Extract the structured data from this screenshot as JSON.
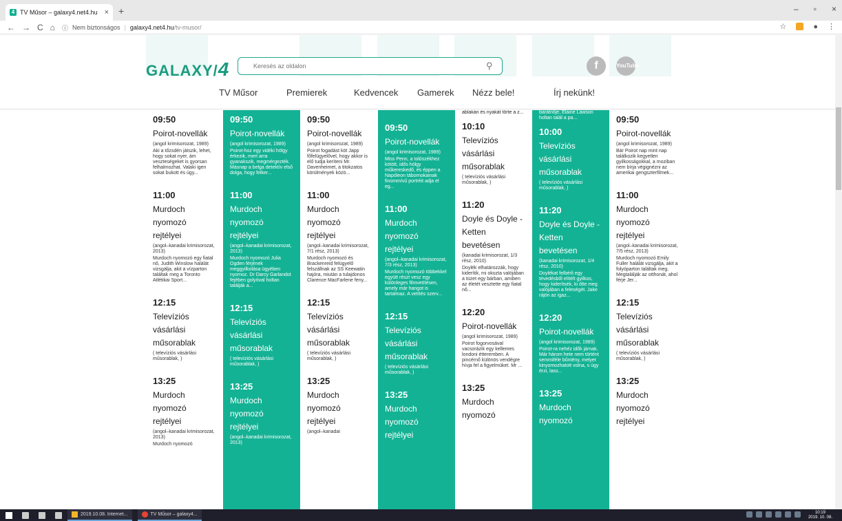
{
  "browser": {
    "tab_title": "TV Műsor – galaxy4.net4.hu",
    "tab_close": "×",
    "new_tab": "+",
    "security_label": "Nem biztonságos",
    "url_host": "galaxy4.net4.hu",
    "url_path": "/tv-musor/",
    "nav_back": "←",
    "nav_forward": "→",
    "nav_reload": "C",
    "nav_home": "⌂",
    "win_min": "–",
    "win_max": "▫",
    "win_close": "×"
  },
  "site": {
    "logo_text": "GALAXY/",
    "logo_four": "4",
    "search_placeholder": "Keresés az oldalon",
    "facebook_glyph": "f",
    "youtube_glyph": "YouTube",
    "menu": [
      "TV Műsor",
      "Premierek",
      "Kedvencek",
      "Gamerek",
      "Nézz bele!",
      "Írj nekünk!"
    ],
    "accent_color": "#14b294"
  },
  "schedule": [
    {
      "style": "white",
      "fragment": "",
      "programs": [
        {
          "time": "09:50",
          "title": "Poirot-novellák",
          "subtitle": "(angol krimisorozat, 1989)",
          "desc": "Aki a tőzsdén játszik, lehet, hogy sokat nyer, ám veszteségeket is gyorsan felhalmozhat. Valaki igen sokat bukott és úgy..."
        },
        {
          "time": "11:00",
          "title": "Murdoch nyomozó rejtélyei",
          "subtitle": "(angol–kanadai krimisorozat, 2013)",
          "desc": "Murdoch nyomozó egy fiatal nő, Judith Winslow halálát vizsgálja, akit a vízparton találtak meg a Toronto Atlétikai Sport..."
        },
        {
          "time": "12:15",
          "title": "Televíziós vásárlási műsorablak",
          "subtitle": "( televíziós vásárlási műsorablak, )",
          "desc": ""
        },
        {
          "time": "13:25",
          "title": "Murdoch nyomozó rejtélyei",
          "subtitle": "(angol–kanadai krimisorozat, 2013)",
          "desc": "Murdoch nyomozó"
        }
      ]
    },
    {
      "style": "green",
      "fragment": "",
      "programs": [
        {
          "time": "09:50",
          "title": "Poirot-novellák",
          "subtitle": "(angol krimisorozat, 1989)",
          "desc": "Poirot-hoz egy vidéki hölgy érkezik, mert arra gyanakszik, megmérgezték. Másnap a belga detektív első dolga, hogy felker..."
        },
        {
          "time": "11:00",
          "title": "Murdoch nyomozó rejtélyei",
          "subtitle": "(angol–kanadai krimisorozat, 2013)",
          "desc": "Murdoch nyomozó Julia Ogden férjének meggyilkolása ügyében nyomoz. Dr Darcy Garlandot fejében golyóval holtan találják a..."
        },
        {
          "time": "12:15",
          "title": "Televíziós vásárlási műsorablak",
          "subtitle": "( televíziós vásárlási műsorablak, )",
          "desc": ""
        },
        {
          "time": "13:25",
          "title": "Murdoch nyomozó rejtélyei",
          "subtitle": "(angol–kanadai krimisorozat, 2013)",
          "desc": ""
        }
      ]
    },
    {
      "style": "white",
      "fragment": "",
      "programs": [
        {
          "time": "09:50",
          "title": "Poirot-novellák",
          "subtitle": "(angol krimisorozat, 1989)",
          "desc": "Poirot fogadást köt Japp főfelügyelővel, hogy akkor is elő tudja keríteni Mr. Davenheimet, a titokzatos körülmények közö..."
        },
        {
          "time": "11:00",
          "title": "Murdoch nyomozó rejtélyei",
          "subtitle": "(angol–kanadai krimisorozat, 7/1 rész, 2013)",
          "desc": "Murdoch nyomozó és Brackenreid felügyelő felszállnak az SS Keewatin hajóra, miután a tulajdonos Clarence MacFarlene feny..."
        },
        {
          "time": "12:15",
          "title": "Televíziós vásárlási műsorablak",
          "subtitle": "( televíziós vásárlási műsorablak, )",
          "desc": ""
        },
        {
          "time": "13:25",
          "title": "Murdoch nyomozó rejtélyei",
          "subtitle": "(angol–kanadai",
          "desc": ""
        }
      ]
    },
    {
      "style": "green",
      "fragment": "",
      "programs": [
        {
          "time": "09:50",
          "title": "Poirot-novellák",
          "subtitle": "(angol krimisorozat, 1989)",
          "desc": "Miss Penn, a tolószékhez kötött, idős hölgy műkereskedő, és éppen a Napóleon tábornokainak finommívű portréit adja el eg..."
        },
        {
          "time": "11:00",
          "title": "Murdoch nyomozó rejtélyei",
          "subtitle": "(angol–kanadai krimisorozat, 7/3 rész, 2013)",
          "desc": "Murdoch nyomozó többekkel együtt részt vesz egy különleges filmvetítésen, amely már hangot is tartalmaz. A vetítés szerv..."
        },
        {
          "time": "12:15",
          "title": "Televíziós vásárlási műsorablak",
          "subtitle": "( televíziós vásárlási műsorablak, )",
          "desc": ""
        },
        {
          "time": "13:25",
          "title": "Murdoch nyomozó rejtélyei",
          "subtitle": "",
          "desc": ""
        }
      ]
    },
    {
      "style": "white",
      "fragment": "ablakán és nyakát törte a z...",
      "programs": [
        {
          "time": "10:10",
          "title": "Televíziós vásárlási műsorablak",
          "subtitle": "( televíziós vásárlási műsorablak, )",
          "desc": ""
        },
        {
          "time": "11:20",
          "title": "Doyle és Doyle - Ketten bevetésen",
          "subtitle": "(kanadai krimisorozat, 1/3 rész, 2010)",
          "desc": "Doylék elhatározzák, hogy kiderítik, mi okozta valójában a tüzet egy bárban, amiben az életét vesztette egy fiatal nő..."
        },
        {
          "time": "12:20",
          "title": "Poirot-novellák",
          "subtitle": "(angol krimisorozat, 1989)",
          "desc": "Poirot fogorvosával vacsorázik egy kellemes londoni étteremben. A pincérnő különös vendégre hívja fel a figyelmüket. Mr ..."
        },
        {
          "time": "13:25",
          "title": "Murdoch nyomozó",
          "subtitle": "",
          "desc": ""
        }
      ]
    },
    {
      "style": "green",
      "fragment": "barátnője, Elaine Lawson holtan talál a pa...",
      "programs": [
        {
          "time": "10:00",
          "title": "Televíziós vásárlási műsorablak",
          "subtitle": "( televíziós vásárlási műsorablak, )",
          "desc": ""
        },
        {
          "time": "11:20",
          "title": "Doyle és Doyle - Ketten bevetésen",
          "subtitle": "(kanadai krimisorozat, 1/4 rész, 2010)",
          "desc": "Doylékat felbérli egy tévedésből elítélt gyilkos, hogy kiderítsék, ki ölte meg valójában a feleségét. Jake rájön az igaz..."
        },
        {
          "time": "12:20",
          "title": "Poirot-novellák",
          "subtitle": "(angol krimisorozat, 1989)",
          "desc": "Poirot-ra nehéz idők járnak. Már három hete nem történt semmiféle bűntény, melyet kinyomozhatott volna, s úgy érzi, lass..."
        },
        {
          "time": "13:25",
          "title": "Murdoch nyomozó",
          "subtitle": "",
          "desc": ""
        }
      ]
    },
    {
      "style": "white",
      "fragment": "",
      "programs": [
        {
          "time": "09:50",
          "title": "Poirot-novellák",
          "subtitle": "(angol krimisorozat, 1989)",
          "desc": "Bár Poirot nap mint nap találkozik kegyetlen gyilkosságokkal, a moziban nem bírja végignézni az amerikai gengszterfilmek..."
        },
        {
          "time": "11:00",
          "title": "Murdoch nyomozó rejtélyei",
          "subtitle": "(angol–kanadai krimisorozat, 7/5 rész, 2013)",
          "desc": "Murdoch nyomozó Emily Fuller halálát vizsgálja, akit a folyóparton találtak meg. Megtalálják az otthonát, ahol férje Jer..."
        },
        {
          "time": "12:15",
          "title": "Televíziós vásárlási műsorablak",
          "subtitle": "( televíziós vásárlási műsorablak, )",
          "desc": ""
        },
        {
          "time": "13:25",
          "title": "Murdoch nyomozó rejtélyei",
          "subtitle": "",
          "desc": ""
        }
      ]
    }
  ],
  "taskbar": {
    "task1": "2019.10.08. Internet...",
    "task2": "TV Műsor – galaxy4...",
    "clock_time": "10:19",
    "clock_date": "2019. 10. 08."
  }
}
